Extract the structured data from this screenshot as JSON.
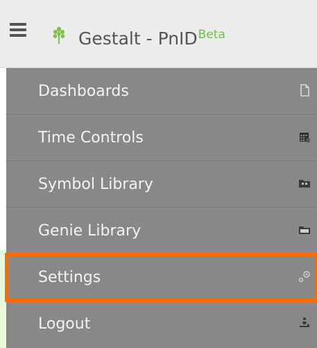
{
  "header": {
    "app_name": "Gestalt - PnID",
    "badge": "Beta",
    "menu_icon": "hamburger-menu-icon",
    "logo_icon": "leaf-logo-icon"
  },
  "menu": {
    "items": [
      {
        "label": "Dashboards",
        "icon": "document-icon"
      },
      {
        "label": "Time Controls",
        "icon": "calendar-icon"
      },
      {
        "label": "Symbol Library",
        "icon": "folder-icon"
      },
      {
        "label": "Genie Library",
        "icon": "folder-icon"
      },
      {
        "label": "Settings",
        "icon": "gear-icon",
        "highlighted": true
      },
      {
        "label": "Logout",
        "icon": "logout-icon"
      }
    ]
  },
  "colors": {
    "header_bg": "#ececec",
    "menu_bg": "#888888",
    "highlight": "#ff6a00",
    "beta": "#6cc24a",
    "logo": "#7cc04b"
  }
}
